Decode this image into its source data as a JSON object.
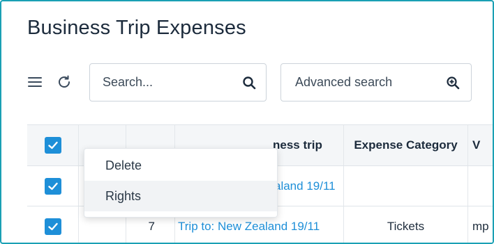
{
  "page": {
    "title": "Business Trip Expenses"
  },
  "toolbar": {
    "search_placeholder": "Search...",
    "advanced_search_label": "Advanced search"
  },
  "table": {
    "headers": [
      "",
      "",
      "",
      "",
      "ness trip",
      "Expense Category",
      "V"
    ],
    "rows": [
      {
        "ref": "",
        "trip": "aland 19/11",
        "category": "",
        "extra": ""
      },
      {
        "ref": "7",
        "trip": "Trip to: New Zealand 19/11",
        "category": "Tickets",
        "extra": "mp"
      }
    ]
  },
  "context_menu": {
    "items": [
      "Delete",
      "Rights"
    ]
  },
  "colors": {
    "accent": "#1e8fd8",
    "frame": "#1aa0b4"
  }
}
